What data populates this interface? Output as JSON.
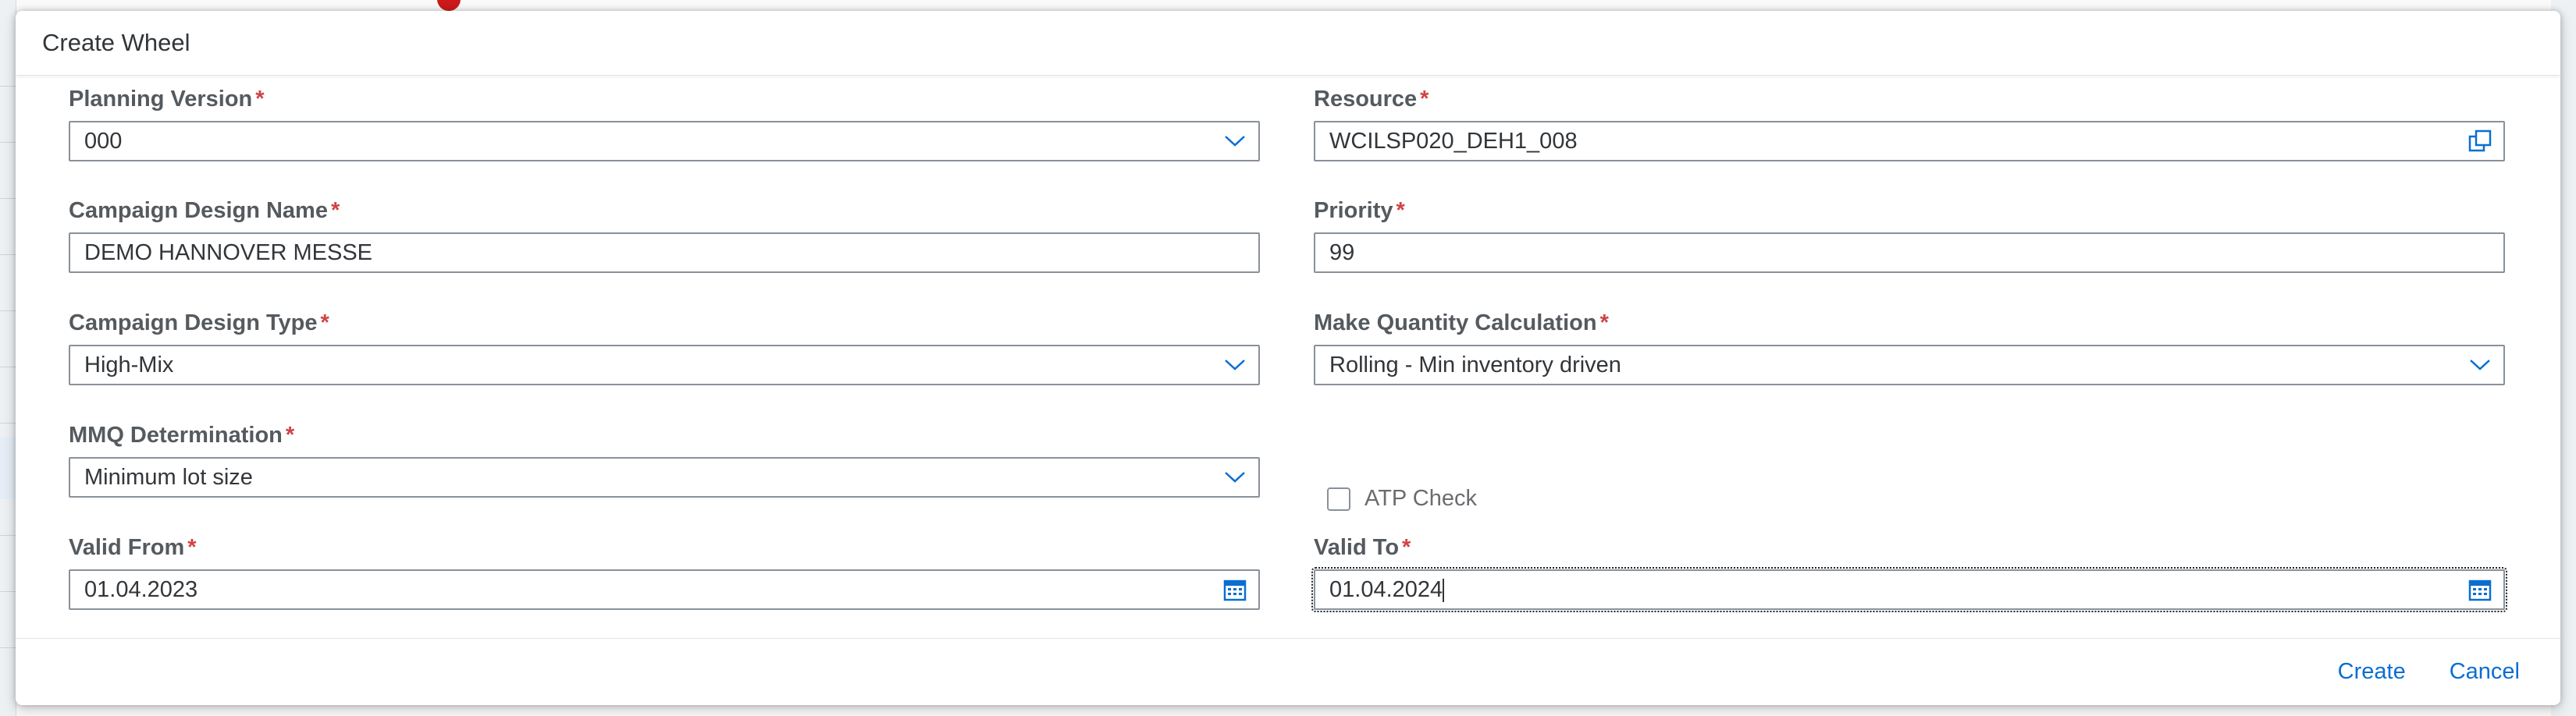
{
  "dialog": {
    "title": "Create Wheel"
  },
  "form": {
    "planning_version": {
      "label": "Planning Version",
      "required": "*",
      "value": "000"
    },
    "resource": {
      "label": "Resource",
      "required": "*",
      "value": "WCILSP020_DEH1_008"
    },
    "campaign_design_name": {
      "label": "Campaign Design Name",
      "required": "*",
      "value": "DEMO HANNOVER MESSE"
    },
    "priority": {
      "label": "Priority",
      "required": "*",
      "value": "99"
    },
    "campaign_design_type": {
      "label": "Campaign Design Type",
      "required": "*",
      "value": "High-Mix"
    },
    "make_quantity_calculation": {
      "label": "Make Quantity Calculation",
      "required": "*",
      "value": "Rolling - Min inventory driven"
    },
    "mmq_determination": {
      "label": "MMQ Determination",
      "required": "*",
      "value": "Minimum lot size"
    },
    "atp_check": {
      "label": "ATP Check",
      "checked": false
    },
    "valid_from": {
      "label": "Valid From",
      "required": "*",
      "value": "01.04.2023"
    },
    "valid_to": {
      "label": "Valid To",
      "required": "*",
      "value": "01.04.2024"
    }
  },
  "footer": {
    "create_label": "Create",
    "cancel_label": "Cancel"
  },
  "colors": {
    "accent": "#0a6ed1",
    "required": "#d04343",
    "border": "#89919a"
  }
}
